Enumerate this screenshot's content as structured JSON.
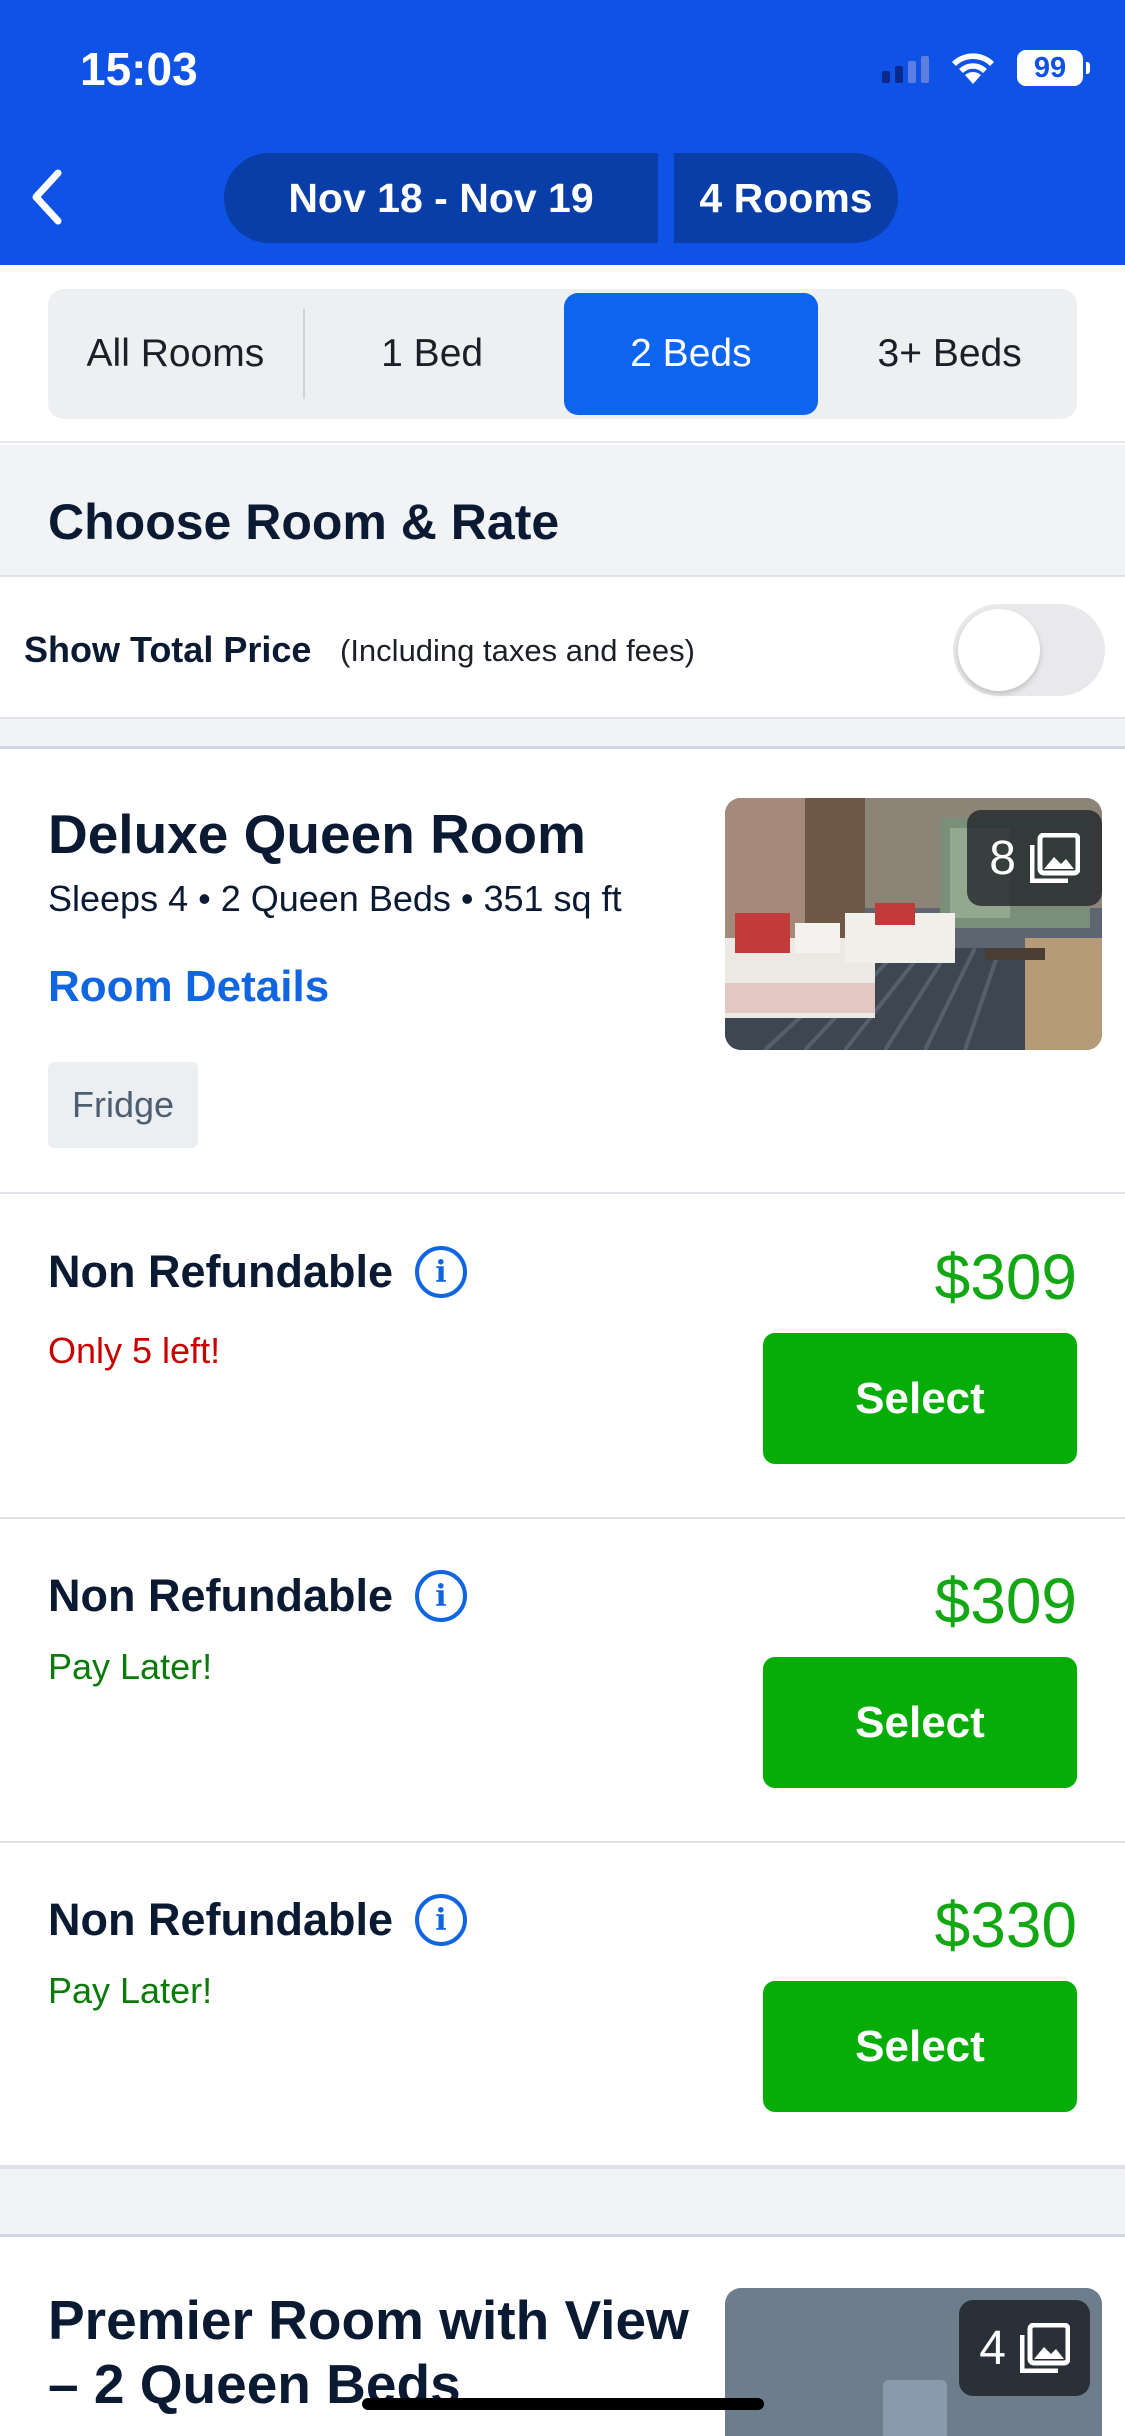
{
  "status_bar": {
    "time": "15:03",
    "battery": "99"
  },
  "header": {
    "dates": "Nov 18 - Nov 19",
    "rooms": "4 Rooms"
  },
  "filters": {
    "tabs": [
      "All Rooms",
      "1 Bed",
      "2 Beds",
      "3+ Beds"
    ],
    "selected": "2 Beds"
  },
  "section": {
    "title": "Choose Room & Rate"
  },
  "total_price": {
    "label": "Show Total Price",
    "note": "(Including taxes and fees)",
    "enabled": false
  },
  "rooms": [
    {
      "name": "Deluxe Queen Room",
      "meta": "Sleeps 4 • 2 Queen Beds • 351 sq ft",
      "details_link": "Room Details",
      "amenity": "Fridge",
      "photo_count": "8",
      "rates": [
        {
          "title": "Non Refundable",
          "note": "Only 5 left!",
          "note_type": "warning",
          "price": "$309",
          "button": "Select"
        },
        {
          "title": "Non Refundable",
          "note": "Pay Later!",
          "note_type": "positive",
          "price": "$309",
          "button": "Select"
        },
        {
          "title": "Non Refundable",
          "note": "Pay Later!",
          "note_type": "positive",
          "price": "$330",
          "button": "Select"
        }
      ]
    },
    {
      "name": "Premier Room with View – 2 Queen Beds",
      "photo_count": "4"
    }
  ],
  "colors": {
    "header": "#0f52e6",
    "accent": "#0d64ef",
    "price": "#13a813",
    "select": "#06ad06",
    "warning": "#c80000",
    "positive": "#0a7a0a"
  }
}
